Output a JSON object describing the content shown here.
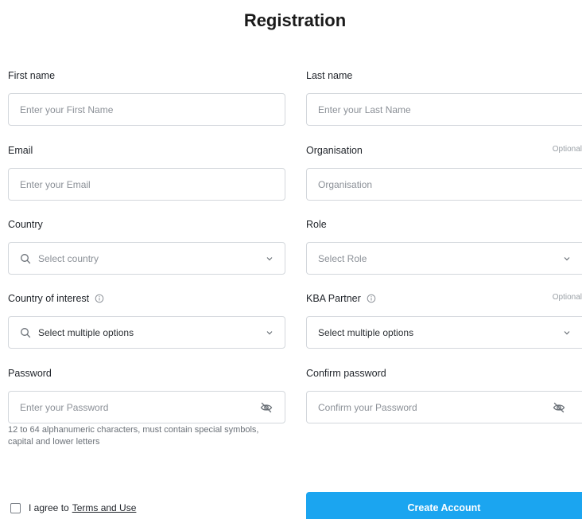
{
  "title": "Registration",
  "fields": {
    "first_name": {
      "label": "First name",
      "placeholder": "Enter your First Name"
    },
    "last_name": {
      "label": "Last name",
      "placeholder": "Enter your Last Name"
    },
    "email": {
      "label": "Email",
      "placeholder": "Enter your Email"
    },
    "organisation": {
      "label": "Organisation",
      "optional": "Optional",
      "placeholder": "Organisation"
    },
    "country": {
      "label": "Country",
      "placeholder": "Select country",
      "lead_icon": "search-icon",
      "trail_icon": "chevron-down-icon"
    },
    "role": {
      "label": "Role",
      "placeholder": "Select Role",
      "trail_icon": "chevron-down-icon"
    },
    "country_of_interest": {
      "label": "Country of interest",
      "placeholder": "Select multiple options",
      "info_icon": "info-icon",
      "lead_icon": "search-icon",
      "trail_icon": "chevron-down-icon"
    },
    "kba_partner": {
      "label": "KBA Partner",
      "optional": "Optional",
      "placeholder": "Select multiple options",
      "info_icon": "info-icon",
      "trail_icon": "chevron-down-icon"
    },
    "password": {
      "label": "Password",
      "placeholder": "Enter your Password",
      "trail_icon": "eye-off-icon",
      "hint": "12 to 64 alphanumeric characters, must contain special symbols, capital and lower letters"
    },
    "confirm_password": {
      "label": "Confirm password",
      "placeholder": "Confirm your Password",
      "trail_icon": "eye-off-icon"
    }
  },
  "agree": {
    "prefix": "I agree to",
    "link": "Terms and Use"
  },
  "create_button": "Create Account",
  "colors": {
    "primary": "#1ba5f0",
    "border": "#d3d7dc",
    "placeholder": "#8b9097"
  }
}
